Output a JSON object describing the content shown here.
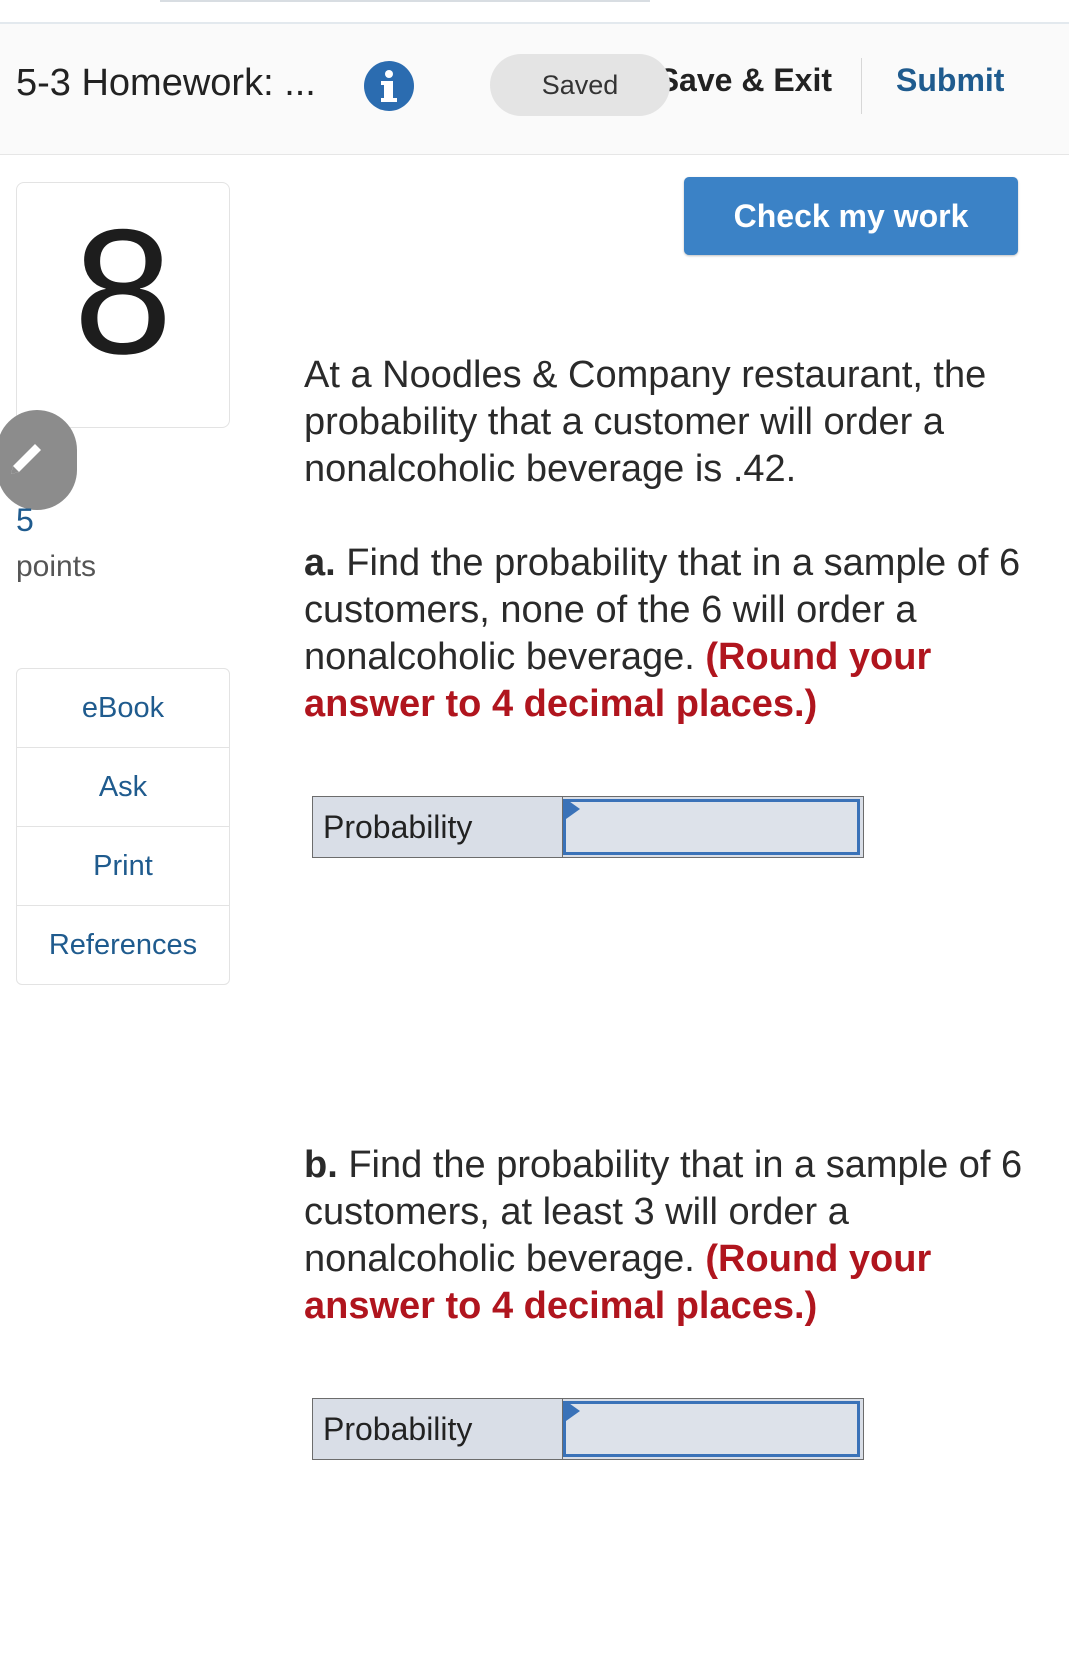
{
  "header": {
    "title": "5-3 Homework: ...",
    "saved_label": "Saved",
    "save_exit_label": "Save & Exit",
    "submit_label": "Submit"
  },
  "question_card": {
    "number": "8",
    "points_value": "5",
    "points_label": "points"
  },
  "side_menu": {
    "items": [
      {
        "label": "eBook"
      },
      {
        "label": "Ask"
      },
      {
        "label": "Print"
      },
      {
        "label": "References"
      }
    ]
  },
  "check_button_label": "Check my work",
  "question": {
    "intro": "At a Noodles & Company restaurant, the probability that a customer will order a nonalcoholic beverage is .42.",
    "part_a": {
      "label": "a.",
      "text": " Find the probability that in a sample of 6 customers, none of the 6 will order a nonalcoholic beverage. ",
      "round_note": "(Round your answer to 4 decimal places.)",
      "answer_label": "Probability",
      "answer_value": ""
    },
    "part_b": {
      "label": "b.",
      "text": " Find the probability that in a sample of 6 customers, at least 3 will order a nonalcoholic beverage. ",
      "round_note": "(Round your answer to 4 decimal places.)",
      "answer_label": "Probability",
      "answer_value": ""
    }
  },
  "colors": {
    "accent_blue": "#3b82c6",
    "link_blue": "#1f5b8e",
    "round_note_red": "#b0151e"
  },
  "icons": {
    "info": "info-icon",
    "edit": "pencil-icon",
    "answer_flag": "flag-icon"
  }
}
